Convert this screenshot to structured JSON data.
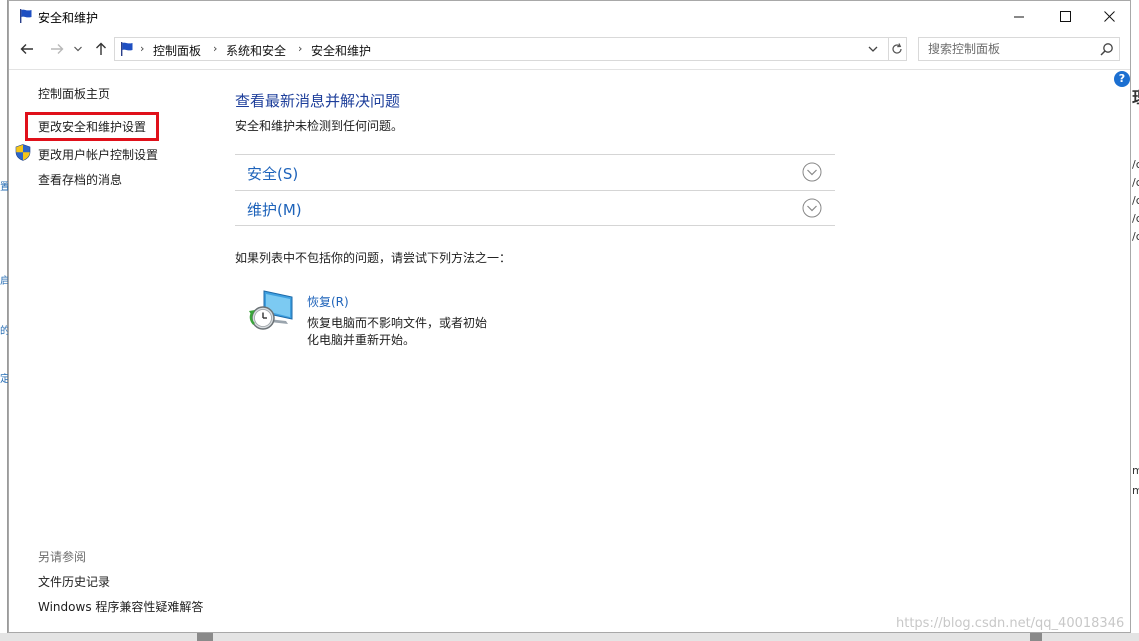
{
  "window": {
    "title": "安全和维护",
    "controls": {
      "minimize": "–",
      "maximize": "☐",
      "close": "✕"
    }
  },
  "address_bar": {
    "breadcrumbs": [
      "控制面板",
      "系统和安全",
      "安全和维护"
    ],
    "separator": "›"
  },
  "search": {
    "placeholder": "搜索控制面板"
  },
  "help_label": "?",
  "left_pane": {
    "home": "控制面板主页",
    "change_security_settings": "更改安全和维护设置",
    "change_uac_settings": "更改用户帐户控制设置",
    "archived_messages": "查看存档的消息",
    "see_also_header": "另请参阅",
    "file_history": "文件历史记录",
    "compat_troubleshooter": "Windows 程序兼容性疑难解答"
  },
  "main": {
    "title": "查看最新消息并解决问题",
    "subtitle": "安全和维护未检测到任何问题。",
    "sections": [
      {
        "label": "安全(S)"
      },
      {
        "label": "维护(M)"
      }
    ],
    "hint": "如果列表中不包括你的问题，请尝试下列方法之一：",
    "recovery": {
      "link": "恢复(R)",
      "desc_line1": "恢复电脑而不影响文件，或者初始",
      "desc_line2": "化电脑并重新开始。"
    }
  },
  "watermark": "https://blog.csdn.net/qq_40018346",
  "colors": {
    "link_blue": "#1e63ba",
    "title_blue": "#1e3f9b",
    "highlight_red": "#e0101a",
    "help_blue": "#1b6fd1"
  }
}
